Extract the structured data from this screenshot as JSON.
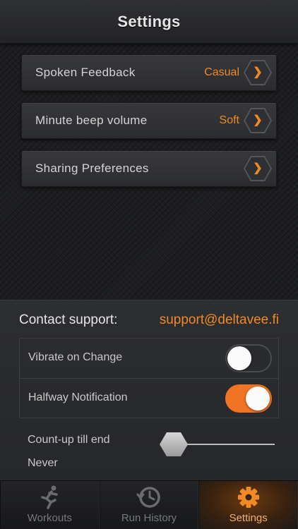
{
  "header": {
    "title": "Settings"
  },
  "settings_rows": [
    {
      "label": "Spoken Feedback",
      "value": "Casual"
    },
    {
      "label": "Minute beep volume",
      "value": "Soft"
    },
    {
      "label": "Sharing Preferences",
      "value": ""
    }
  ],
  "support": {
    "label": "Contact support:",
    "email": "support@deltavee.fi"
  },
  "toggles": [
    {
      "label": "Vibrate on Change",
      "state": "off"
    },
    {
      "label": "Halfway Notification",
      "state": "on"
    }
  ],
  "countup": {
    "label": "Count-up till end",
    "value": "Never",
    "slider_level": 0
  },
  "tabs": [
    {
      "label": "Workouts",
      "icon": "runner-icon"
    },
    {
      "label": "Run History",
      "icon": "history-clock-icon"
    },
    {
      "label": "Settings",
      "icon": "gear-icon"
    }
  ],
  "colors": {
    "accent": "#f08a24",
    "toggle_on": "#f07423"
  }
}
